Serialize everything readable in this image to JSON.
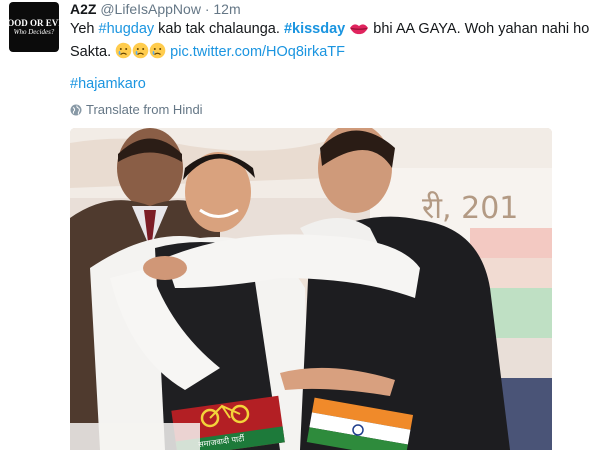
{
  "tweet": {
    "avatar": {
      "line1": "GOOD OR EVIL",
      "line2": "Who Decides?"
    },
    "name": "A2Z",
    "handle": "@LifeIsAppNow",
    "separator": "·",
    "time": "12m",
    "text": {
      "part1": "Yeh ",
      "hashtag1": "#hugday",
      "part2": " kab tak chalaunga. ",
      "hashtag2": "#kissday",
      "part3": " bhi AA GAYA. Woh yahan nahi ho Sakta. ",
      "link": "pic.twitter.com/HOq8irkaTF"
    },
    "hashtag3": "#hajamkaro",
    "translate": "Translate from Hindi",
    "photo": {
      "sign_text": "समाजवादी पार्टी",
      "banner_fragment": "री, 201"
    }
  },
  "colors": {
    "link": "#1b95e0",
    "muted": "#657786",
    "text": "#14171a"
  },
  "icons": [
    "kiss-lips-icon",
    "crying-face-icon",
    "globe-icon",
    "bicycle-icon",
    "hand-symbol-icon"
  ]
}
